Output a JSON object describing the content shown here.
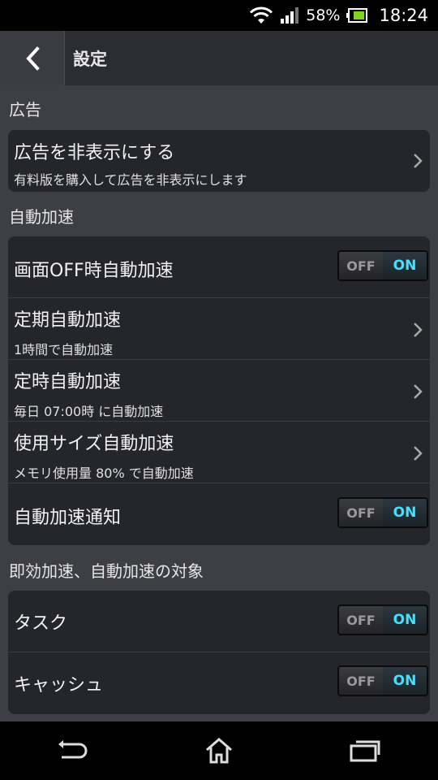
{
  "status": {
    "battery": "58%",
    "time": "18:24"
  },
  "header": {
    "title": "設定"
  },
  "sections": {
    "ads": {
      "label": "広告",
      "remove_ads": {
        "title": "広告を非表示にする",
        "subtitle": "有料版を購入して広告を非表示にします"
      }
    },
    "auto": {
      "label": "自動加速",
      "screen_off": {
        "title": "画面OFF時自動加速"
      },
      "periodic": {
        "title": "定期自動加速",
        "subtitle": "1時間で自動加速"
      },
      "scheduled": {
        "title": "定時自動加速",
        "subtitle": "毎日 07:00時 に自動加速"
      },
      "usage_size": {
        "title": "使用サイズ自動加速",
        "subtitle": "メモリ使用量 80% で自動加速"
      },
      "notify": {
        "title": "自動加速通知"
      }
    },
    "targets": {
      "label": "即効加速、自動加速の対象",
      "task": {
        "title": "タスク"
      },
      "cache": {
        "title": "キャッシュ"
      }
    }
  },
  "toggle": {
    "off": "OFF",
    "on": "ON"
  },
  "icons": {
    "back": "chevron-left-icon",
    "chevron": "chevron-right-icon",
    "nav_back": "back-arrow-icon",
    "nav_home": "home-icon",
    "nav_recents": "recents-icon"
  },
  "colors": {
    "toggle_on": "#3fe3ff",
    "background": "#3d3f45",
    "card": "#25262b"
  }
}
